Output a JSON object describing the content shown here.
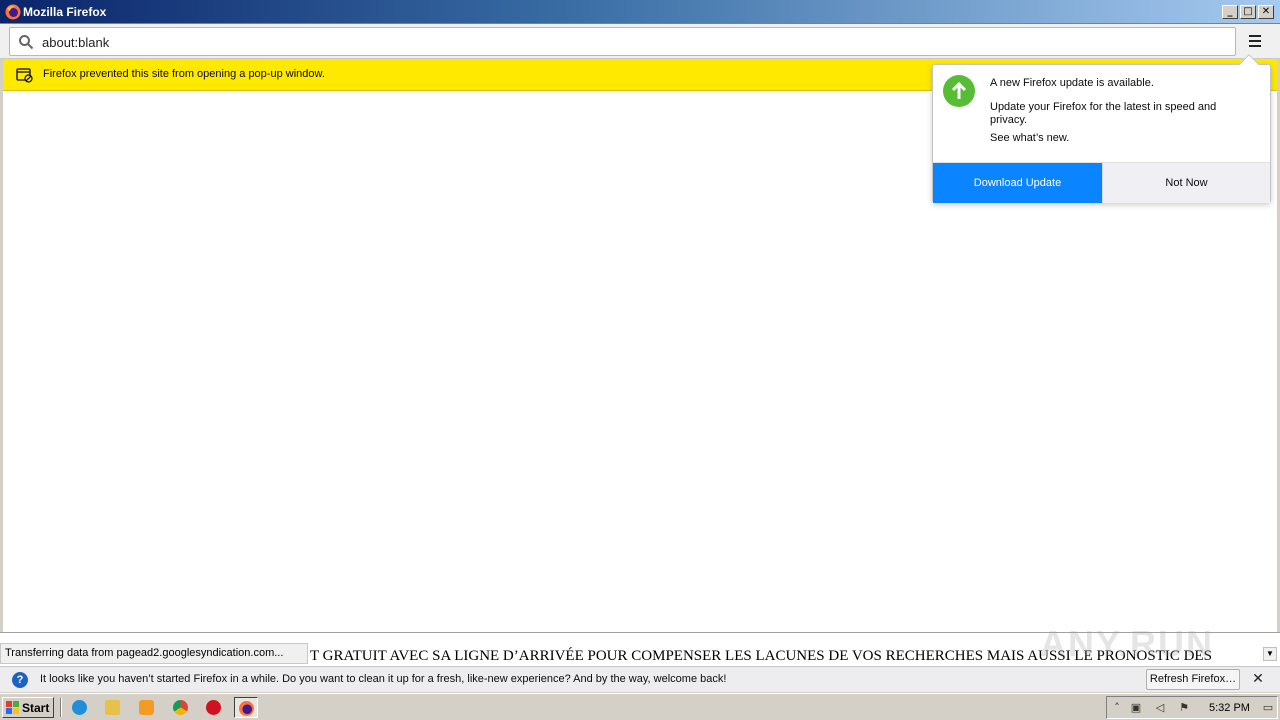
{
  "window": {
    "title": "Mozilla Firefox",
    "buttons": {
      "minimize": "_",
      "maximize": "□",
      "close": "✕"
    }
  },
  "navbar": {
    "url": "about:blank",
    "menu_icon": "hamburger-menu-icon"
  },
  "popup_notification": {
    "text": "Firefox prevented this site from opening a pop-up window."
  },
  "update_doorhanger": {
    "title": "A new Firefox update is available.",
    "description": "Update your Firefox for the latest in speed and privacy.",
    "link": "See what’s new.",
    "primary_button": "Download Update",
    "secondary_button": "Not Now",
    "icon_color": "#57bd35",
    "primary_color": "#0a84ff"
  },
  "status": {
    "transfer_text": "Transferring data from pagead2.googlesyndication.com...",
    "marquee_text": "T GRATUIT AVEC SA LIGNE D’ARRIVÉE POUR COMPENSER LES LACUNES DE VOS RECHERCHES MAIS AUSSI LE PRONOSTIC DES",
    "watermark": "ANY.RUN"
  },
  "refresh_bar": {
    "text": "It looks like you haven’t started Firefox in a while. Do you want to clean it up for a fresh, like-new experience? And by the way, welcome back!",
    "button": "Refresh Firefox…",
    "close": "✕"
  },
  "taskbar": {
    "start_label": "Start",
    "apps": [
      "internet-explorer-icon",
      "explorer-folder-icon",
      "media-player-icon",
      "chrome-icon",
      "opera-icon",
      "firefox-icon"
    ],
    "clock": "5:32 PM"
  }
}
